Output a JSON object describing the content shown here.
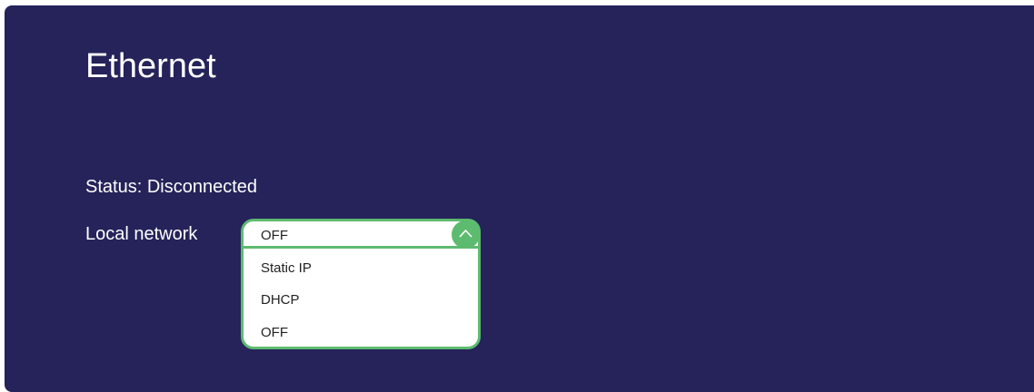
{
  "page": {
    "title": "Ethernet",
    "status_text": "Status: Disconnected"
  },
  "local_network": {
    "label": "Local network",
    "selected": "OFF",
    "options": [
      "Static IP",
      "DHCP",
      "OFF"
    ]
  },
  "icons": {
    "dropdown_toggle": "chevron-up-icon"
  },
  "colors": {
    "background": "#25235a",
    "accent": "#5dbb6f",
    "text": "#ffffff"
  }
}
